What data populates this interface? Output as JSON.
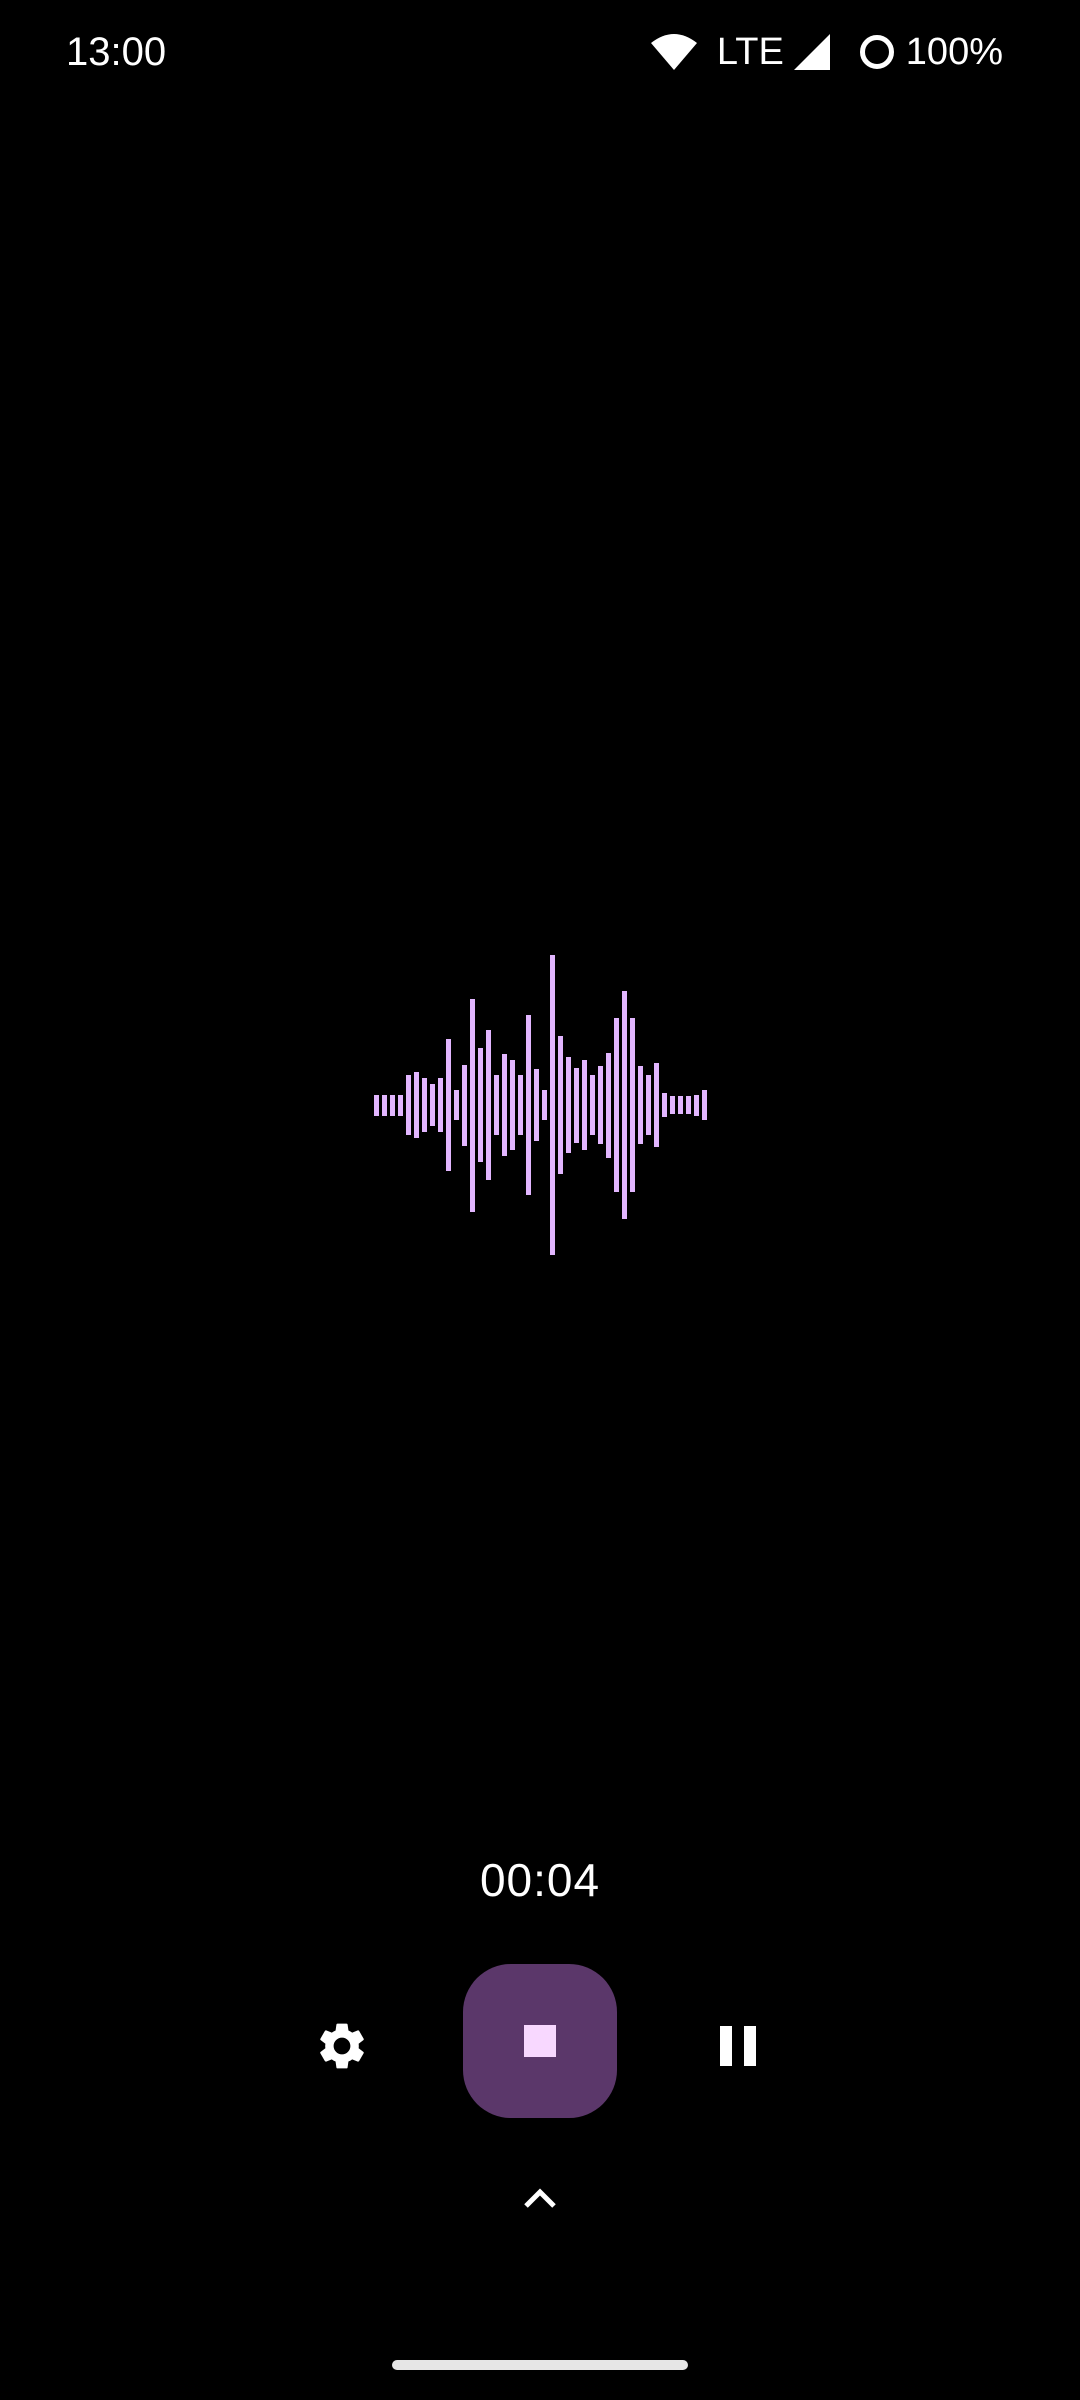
{
  "status_bar": {
    "time": "13:00",
    "network": "LTE",
    "battery": "100%",
    "icons": [
      "wifi-icon",
      "signal-icon",
      "battery-icon"
    ]
  },
  "waveform": {
    "color": "#e2b6ff",
    "levels": [
      0.07,
      0.07,
      0.07,
      0.07,
      0.2,
      0.22,
      0.18,
      0.14,
      0.18,
      0.44,
      0.1,
      0.27,
      0.71,
      0.38,
      0.5,
      0.2,
      0.34,
      0.3,
      0.2,
      0.6,
      0.24,
      0.1,
      1.0,
      0.46,
      0.32,
      0.25,
      0.3,
      0.2,
      0.26,
      0.35,
      0.58,
      0.76,
      0.58,
      0.26,
      0.2,
      0.28,
      0.08,
      0.06,
      0.06,
      0.06,
      0.07,
      0.1
    ]
  },
  "recorder": {
    "elapsed": "00:04",
    "accent_color": "#5b376a",
    "stop_icon_color": "#f8d8ff"
  },
  "controls": {
    "settings_icon": "gear-icon",
    "stop_icon": "stop-icon",
    "pause_icon": "pause-icon",
    "expand_icon": "chevron-up-icon"
  }
}
